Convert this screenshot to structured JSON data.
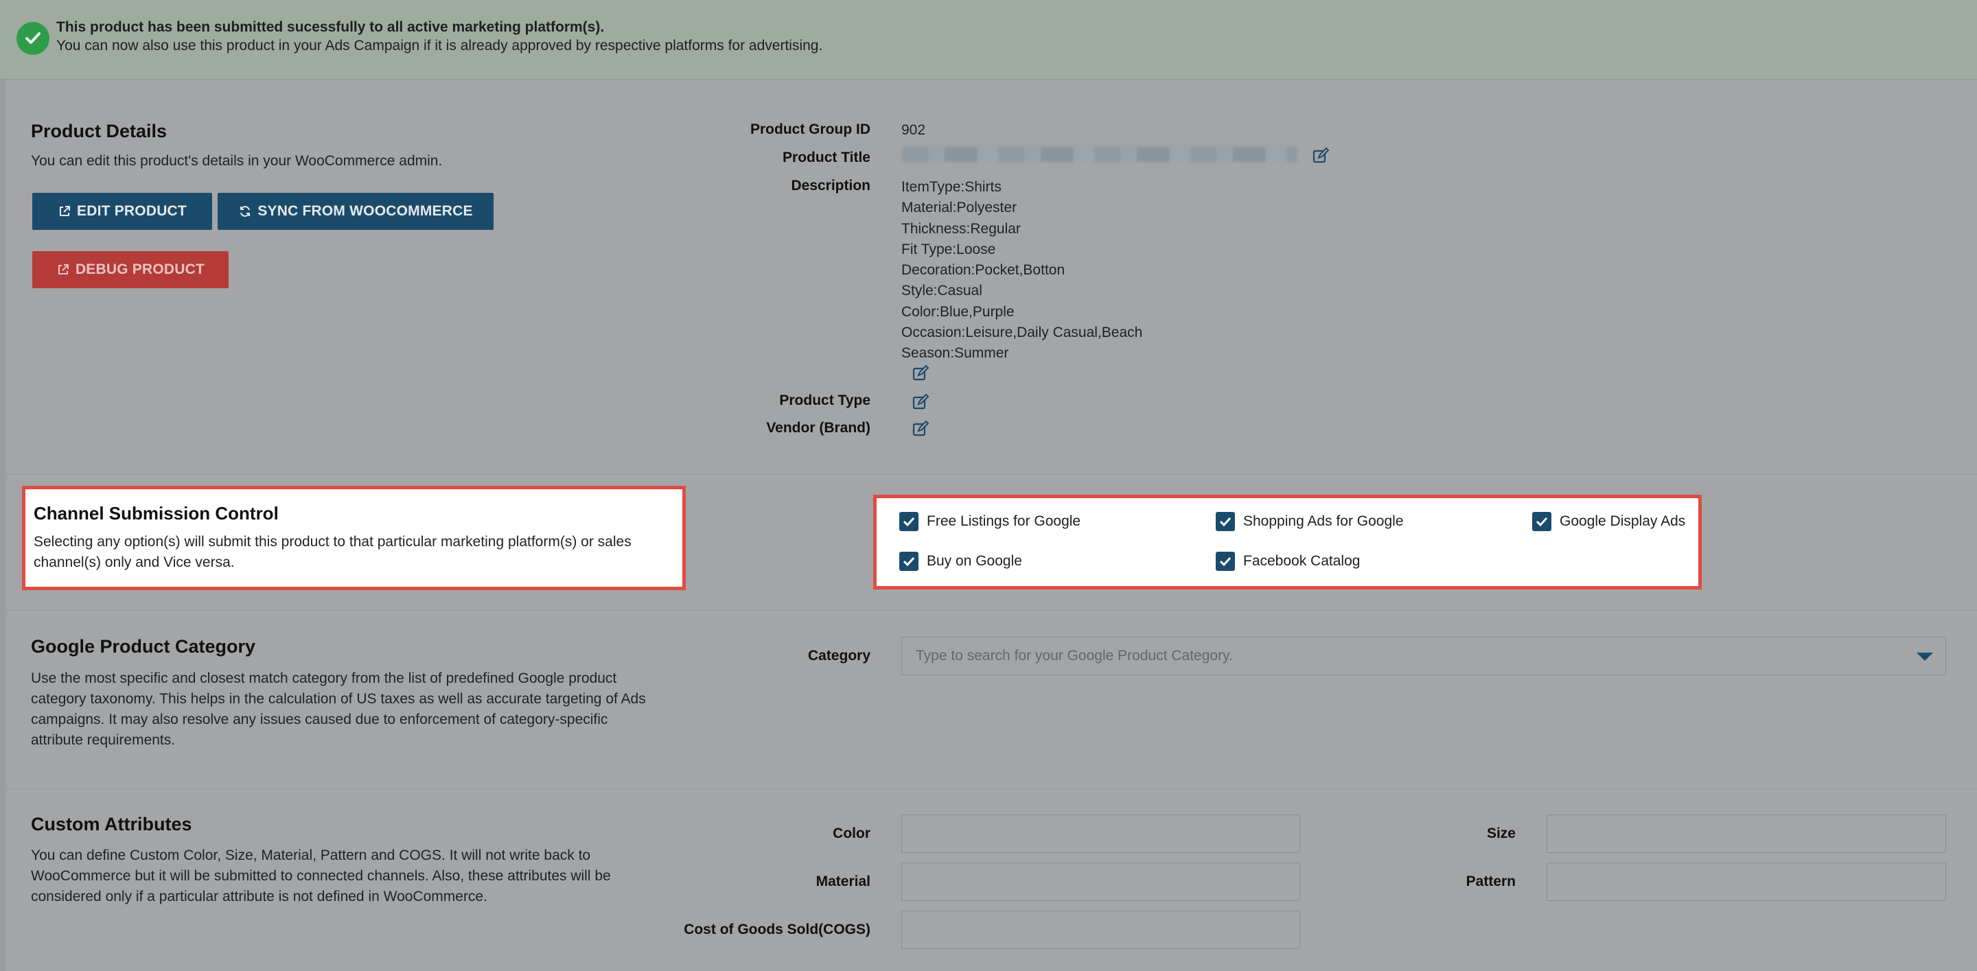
{
  "notice": {
    "title": "This product has been submitted sucessfully to all active marketing platform(s).",
    "text": "You can now also use this product in your Ads Campaign if it is already approved by respective platforms for advertising."
  },
  "product_details": {
    "title": "Product Details",
    "text": "You can edit this product's details in your WooCommerce admin.",
    "edit_button": "EDIT PRODUCT",
    "sync_button": "SYNC FROM WOOCOMMERCE",
    "debug_button": "DEBUG PRODUCT"
  },
  "fields": {
    "group_id_label": "Product Group ID",
    "group_id_value": "902",
    "title_label": "Product Title",
    "description_label": "Description",
    "description_lines": [
      "ItemType:Shirts",
      "Material:Polyester",
      "Thickness:Regular",
      "Fit Type:Loose",
      "Decoration:Pocket,Botton",
      "Style:Casual",
      "Color:Blue,Purple",
      "Occasion:Leisure,Daily Casual,Beach",
      "Season:Summer"
    ],
    "type_label": "Product Type",
    "vendor_label": "Vendor (Brand)"
  },
  "channel": {
    "title": "Channel Submission Control",
    "text_line1": "Selecting any option(s) will submit this product to that particular marketing platform(s) or sales",
    "text_line2": "channel(s) only and Vice versa.",
    "options": [
      {
        "label": "Free Listings for Google",
        "checked": true
      },
      {
        "label": "Shopping Ads for Google",
        "checked": true
      },
      {
        "label": "Google Display Ads",
        "checked": true
      },
      {
        "label": "Buy on Google",
        "checked": true
      },
      {
        "label": "Facebook Catalog",
        "checked": true
      }
    ]
  },
  "category": {
    "title": "Google Product Category",
    "lines": [
      "Use the most specific and closest match category from the list of predefined Google product",
      "category taxonomy. This helps in the calculation of US taxes as well as accurate targeting of Ads",
      "campaigns. It may also resolve any issues caused due to enforcement of category-specific",
      "attribute requirements."
    ],
    "label": "Category",
    "placeholder": "Type to search for your Google Product Category."
  },
  "custom": {
    "title": "Custom Attributes",
    "lines": [
      "You can define Custom Color, Size, Material, Pattern and COGS. It will not write back to",
      "WooCommerce but it will be submitted to connected channels. Also, these attributes will be",
      "considered only if a particular attribute is not defined in WooCommerce."
    ],
    "color_label": "Color",
    "size_label": "Size",
    "material_label": "Material",
    "pattern_label": "Pattern",
    "cogs_label": "Cost of Goods Sold(COGS)"
  },
  "colors": {
    "primary": "#1b4b6b",
    "danger": "#b53b39",
    "success": "#2e9d49",
    "highlight_border": "#e14b3f"
  }
}
